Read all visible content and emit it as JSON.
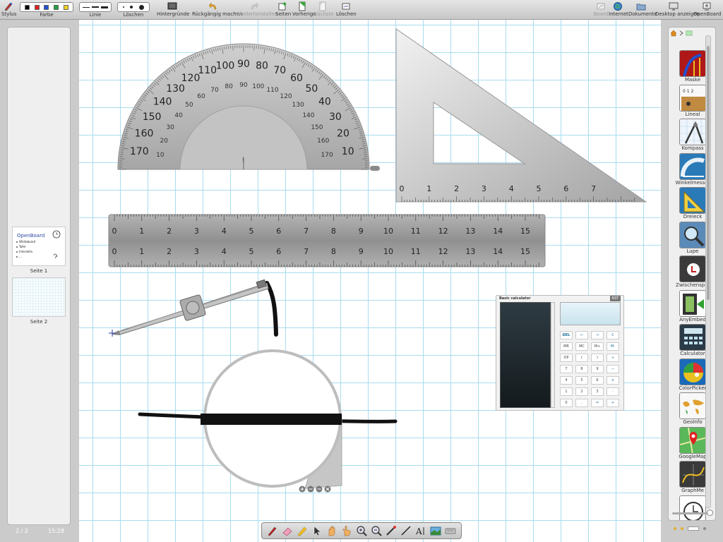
{
  "toolbar": {
    "stylus": "Stylus",
    "color": "Farbe",
    "line": "Linie",
    "erase": "Löschen",
    "backgrounds": "Hintergründe",
    "undo": "Rückgängig machen",
    "redo": "Wiederherstellen",
    "pages": "Seiten",
    "previous": "Vorherige",
    "next": "Nächste",
    "clear": "Löschen",
    "board": "Board",
    "internet": "Internet",
    "documents": "Dokumente",
    "desktop": "Desktop anzeigen",
    "openboard": "OpenBoard",
    "colors": [
      "#000000",
      "#e02020",
      "#2050d0",
      "#20a040",
      "#f0d020"
    ]
  },
  "pages": {
    "items": [
      {
        "label": "Seite 1",
        "thumb_title": "OpenBoard",
        "thumb_lines": [
          "Whiteboard",
          "Tafel",
          "Interaktiv",
          "..."
        ]
      },
      {
        "label": "Seite 2"
      }
    ],
    "counter": "2 / 2",
    "clock": "15:28"
  },
  "protractor": {
    "outer": [
      "170",
      "160",
      "150",
      "140",
      "130",
      "120",
      "110",
      "100",
      "90",
      "80",
      "70",
      "60",
      "50",
      "40",
      "30",
      "20",
      "10"
    ],
    "inner": [
      "10",
      "20",
      "30",
      "40",
      "50",
      "60",
      "70",
      "80",
      "90",
      "100",
      "110",
      "120",
      "130",
      "140",
      "150",
      "160",
      "170"
    ]
  },
  "triangle": {
    "ticks": [
      "0",
      "1",
      "2",
      "3",
      "4",
      "5",
      "6",
      "7"
    ]
  },
  "ruler": {
    "ticks": [
      "0",
      "1",
      "2",
      "3",
      "4",
      "5",
      "6",
      "7",
      "8",
      "9",
      "10",
      "11",
      "12",
      "13",
      "14",
      "15"
    ]
  },
  "calculator": {
    "title": "Basic calculator",
    "reset": "RST",
    "keys": [
      [
        "DEL",
        "←",
        "→",
        "C"
      ],
      [
        "MR",
        "MC",
        "M+",
        "M-"
      ],
      [
        "OP",
        "(",
        ")",
        "÷"
      ],
      [
        "7",
        "8",
        "9",
        "−"
      ],
      [
        "4",
        "5",
        "6",
        "×"
      ],
      [
        "1",
        "2",
        "3",
        "·"
      ],
      [
        "0",
        ".",
        "=",
        "+"
      ]
    ]
  },
  "library": {
    "items": [
      {
        "label": "Maske",
        "icon": "mask-icon"
      },
      {
        "label": "Lineal",
        "icon": "ruler-icon"
      },
      {
        "label": "Kompass",
        "icon": "compass-icon"
      },
      {
        "label": "Winkelmesser",
        "icon": "protractor-icon"
      },
      {
        "label": "Dreieck",
        "icon": "triangle-icon"
      },
      {
        "label": "Lupe",
        "icon": "magnifier-icon"
      },
      {
        "label": "Zwischensp...",
        "icon": "clipboard-icon"
      },
      {
        "label": "AnyEmbed",
        "icon": "film-icon"
      },
      {
        "label": "Calculator",
        "icon": "calculator-icon"
      },
      {
        "label": "ColorPicker",
        "icon": "colorpicker-icon"
      },
      {
        "label": "GeoInfo",
        "icon": "worldmap-icon"
      },
      {
        "label": "GoogleMap",
        "icon": "map-pin-icon"
      },
      {
        "label": "GraphMe",
        "icon": "graph-icon"
      },
      {
        "label": "",
        "icon": "clock-icon"
      }
    ]
  },
  "palette": {
    "tools": [
      "pen-icon",
      "eraser-icon",
      "marker-icon",
      "selector-icon",
      "hand-icon",
      "pointer-hand-icon",
      "zoom-in-icon",
      "zoom-out-icon",
      "laser-icon",
      "line-icon",
      "text-icon",
      "capture-icon",
      "keyboard-icon"
    ]
  }
}
